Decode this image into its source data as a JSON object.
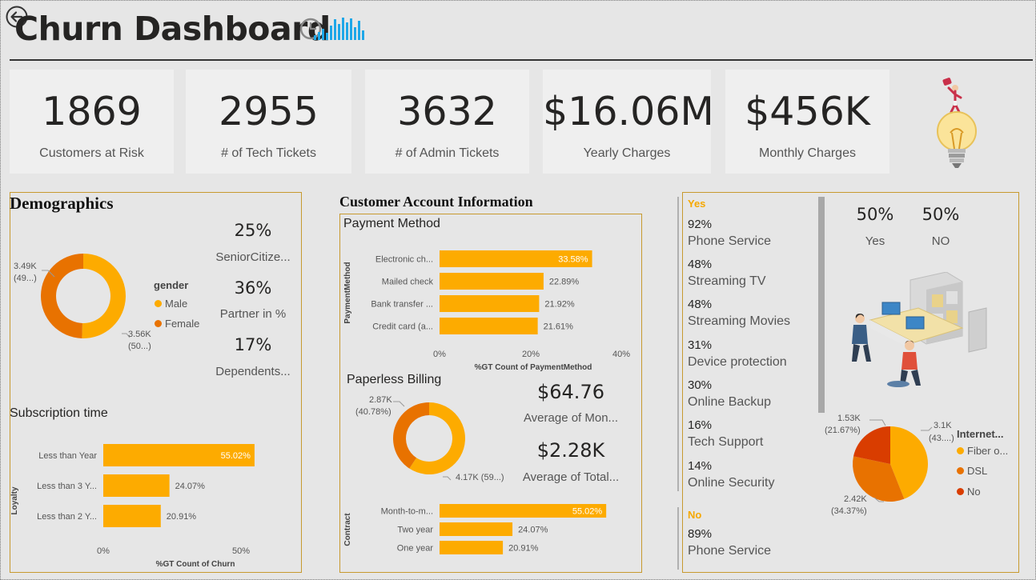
{
  "header": {
    "title": "Churn Dashboard"
  },
  "kpis": [
    {
      "value": "1869",
      "label": "Customers at Risk"
    },
    {
      "value": "2955",
      "label": "# of Tech Tickets"
    },
    {
      "value": "3632",
      "label": "# of Admin Tickets"
    },
    {
      "value": "$16.06M",
      "label": "Yearly Charges"
    },
    {
      "value": "$456K",
      "label": "Monthly Charges"
    }
  ],
  "demographics": {
    "title": "Demographics",
    "stats": [
      {
        "value": "25%",
        "label": "SeniorCitize..."
      },
      {
        "value": "36%",
        "label": "Partner in %"
      },
      {
        "value": "17%",
        "label": "Dependents..."
      }
    ],
    "gender_legend_title": "gender",
    "gender_legend": [
      "Male",
      "Female"
    ],
    "donut_labels": {
      "male_top": "3.49K",
      "male_bottom": "(49...)",
      "female_top": "3.56K",
      "female_bottom": "(50...)"
    },
    "subscription_title": "Subscription time",
    "subscription_ylabel": "Loyalty",
    "subscription_xlabel": "%GT Count of Churn",
    "subscription_ticks": [
      "0%",
      "50%"
    ]
  },
  "account": {
    "title": "Customer Account Information",
    "payment_title": "Payment Method",
    "payment_ylabel": "PaymentMethod",
    "payment_xlabel": "%GT Count of PaymentMethod",
    "payment_ticks": [
      "0%",
      "20%",
      "40%"
    ],
    "paperless_title": "Paperless Billing",
    "paperless_labels": {
      "top": "2.87K",
      "top2": "(40.78%)",
      "bottom": "4.17K (59...)"
    },
    "avg_monthly_value": "$64.76",
    "avg_monthly_label": "Average of Mon...",
    "avg_total_value": "$2.28K",
    "avg_total_label": "Average of Total...",
    "contract_ylabel": "Contract"
  },
  "services": {
    "yes_head": "Yes",
    "no_head": "No",
    "yes_items": [
      {
        "pct": "92%",
        "label": "Phone Service"
      },
      {
        "pct": "48%",
        "label": "Streaming TV"
      },
      {
        "pct": "48%",
        "label": "Streaming Movies"
      },
      {
        "pct": "31%",
        "label": "Device protection"
      },
      {
        "pct": "30%",
        "label": "Online Backup"
      },
      {
        "pct": "16%",
        "label": "Tech Support"
      },
      {
        "pct": "14%",
        "label": "Online Security"
      }
    ],
    "no_items": [
      {
        "pct": "89%",
        "label": "Phone Service"
      }
    ],
    "split": [
      {
        "value": "50%",
        "label": "Yes"
      },
      {
        "value": "50%",
        "label": "NO"
      }
    ],
    "internet_legend_title": "Internet...",
    "internet_legend": [
      "Fiber o...",
      "DSL",
      "No"
    ],
    "pie_labels": {
      "fiber_top": "3.1K",
      "fiber_bottom": "(43....)",
      "dsl_top": "2.42K",
      "dsl_bottom": "(34.37%)",
      "no_top": "1.53K",
      "no_bottom": "(21.67%)"
    }
  },
  "colors": {
    "accent": "#fdab00",
    "secondary": "#e87200",
    "tertiary": "#d93d00",
    "border": "#c79a2f"
  },
  "chart_data": [
    {
      "type": "bar",
      "orientation": "horizontal",
      "title": "Subscription time",
      "ylabel": "Loyalty",
      "xlabel": "%GT Count of Churn",
      "categories": [
        "Less than Year",
        "Less than 3 Y...",
        "Less than 2 Y..."
      ],
      "values": [
        55.02,
        24.07,
        20.91
      ],
      "value_labels": [
        "55.02%",
        "24.07%",
        "20.91%"
      ],
      "xlim": [
        0,
        60
      ]
    },
    {
      "type": "bar",
      "orientation": "horizontal",
      "title": "Payment Method",
      "ylabel": "PaymentMethod",
      "xlabel": "%GT Count of PaymentMethod",
      "categories": [
        "Electronic ch...",
        "Mailed check",
        "Bank transfer ...",
        "Credit card (a..."
      ],
      "values": [
        33.58,
        22.89,
        21.92,
        21.61
      ],
      "value_labels": [
        "33.58%",
        "22.89%",
        "21.92%",
        "21.61%"
      ],
      "xlim": [
        0,
        40
      ]
    },
    {
      "type": "bar",
      "orientation": "horizontal",
      "ylabel": "Contract",
      "categories": [
        "Month-to-m...",
        "Two year",
        "One year"
      ],
      "values": [
        55.02,
        24.07,
        20.91
      ],
      "value_labels": [
        "55.02%",
        "24.07%",
        "20.91%"
      ],
      "xlim": [
        0,
        60
      ]
    },
    {
      "type": "pie",
      "title": "gender",
      "categories": [
        "Male",
        "Female"
      ],
      "values": [
        3490,
        3560
      ]
    },
    {
      "type": "pie",
      "title": "Paperless Billing",
      "values": [
        2870,
        4170
      ],
      "value_labels": [
        "2.87K (40.78%)",
        "4.17K (59...)"
      ]
    },
    {
      "type": "pie",
      "title": "Internet...",
      "categories": [
        "Fiber o...",
        "DSL",
        "No"
      ],
      "values": [
        3100,
        2420,
        1530
      ]
    }
  ]
}
